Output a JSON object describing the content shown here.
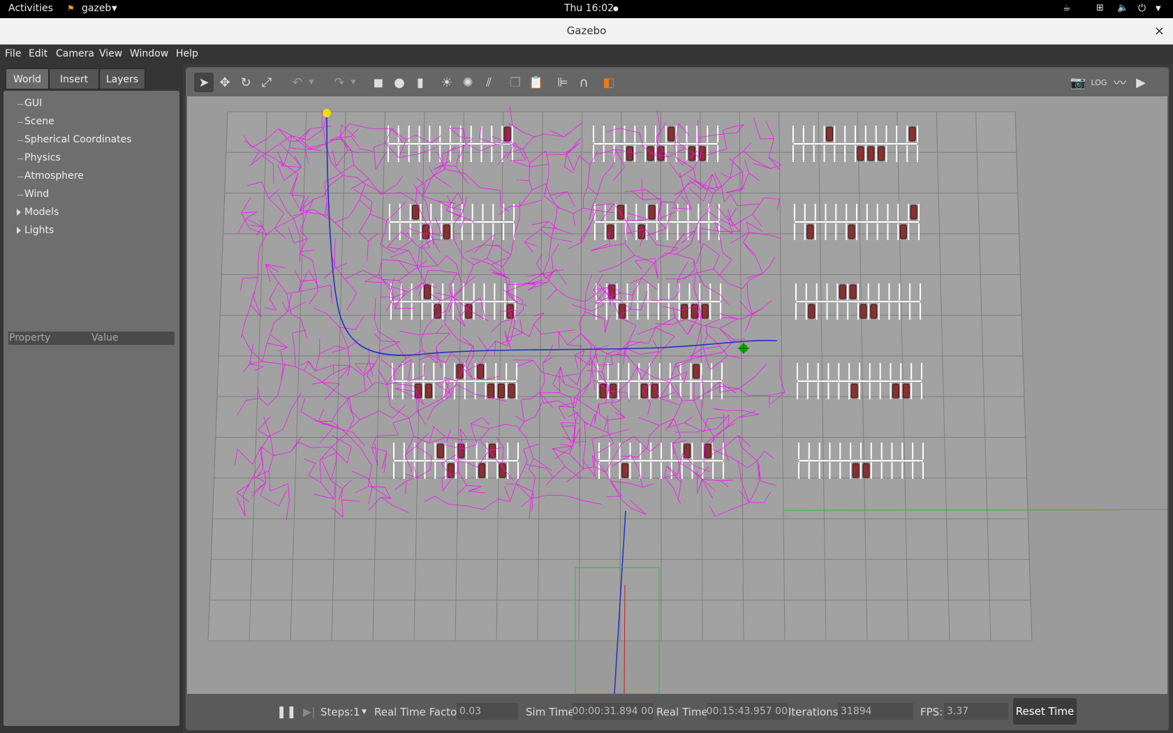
{
  "system_bar": {
    "activities": "Activities",
    "app_name": "gazeb",
    "clock": "Thu 16:02"
  },
  "window": {
    "title": "Gazebo",
    "close": "×"
  },
  "menu": [
    "File",
    "Edit",
    "Camera",
    "View",
    "Window",
    "Help"
  ],
  "left_panel": {
    "tabs": [
      "World",
      "Insert",
      "Layers"
    ],
    "active_tab": "World",
    "tree": [
      "GUI",
      "Scene",
      "Spherical Coordinates",
      "Physics",
      "Atmosphere",
      "Wind",
      "Models",
      "Lights"
    ],
    "property_header": {
      "property": "Property",
      "value": "Value"
    }
  },
  "toolbar": {
    "icons": [
      "select-arrow-icon",
      "translate-icon",
      "rotate-icon",
      "scale-icon",
      "undo-icon",
      "redo-icon",
      "box-icon",
      "sphere-icon",
      "cylinder-icon",
      "point-light-icon",
      "spot-light-icon",
      "directional-light-icon",
      "copy-icon",
      "paste-icon",
      "align-icon",
      "snap-icon",
      "view-angle-icon",
      "screenshot-icon",
      "log-icon",
      "plot-icon",
      "video-icon"
    ]
  },
  "bottom_bar": {
    "steps_label": "Steps:",
    "steps_value": "1",
    "rtf_label": "Real Time Factor:",
    "rtf_value": "0.03",
    "sim_time_label": "Sim Time:",
    "sim_time_value": "00 00:00:31.894",
    "real_time_label": "Real Time:",
    "real_time_value": "00 00:15:43.957",
    "iterations_label": "Iterations:",
    "iterations_value": "31894",
    "fps_label": "FPS:",
    "fps_value": "3.37",
    "reset_label": "Reset Time"
  },
  "colors": {
    "rrt_tree": "#ff00ff",
    "path": "#2030c0",
    "start_marker": "#f0e000",
    "goal_marker": "#00b000",
    "parking_lines": "#ffffff",
    "car": "#8a3030",
    "ground": "#9b9b9b",
    "grid": "#7e7e7e"
  }
}
